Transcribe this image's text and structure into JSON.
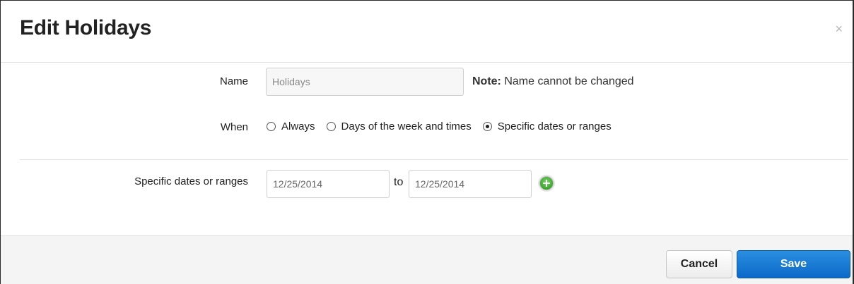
{
  "dialog": {
    "title": "Edit Holidays",
    "close_glyph": "×"
  },
  "form": {
    "name_label": "Name",
    "name_value": "Holidays",
    "note_bold": "Note:",
    "note_text": " Name cannot be changed",
    "when_label": "When",
    "when_options": [
      {
        "label": "Always",
        "selected": false
      },
      {
        "label": "Days of the week and times",
        "selected": false
      },
      {
        "label": "Specific dates or ranges",
        "selected": true
      }
    ],
    "dates_label": "Specific dates or ranges",
    "date_from": "12/25/2014",
    "to_label": "to",
    "date_to": "12/25/2014",
    "add_icon": "add-circle-icon"
  },
  "footer": {
    "cancel_label": "Cancel",
    "save_label": "Save"
  },
  "colors": {
    "primary": "#1279d6",
    "add_icon_green": "#3aa62a"
  }
}
